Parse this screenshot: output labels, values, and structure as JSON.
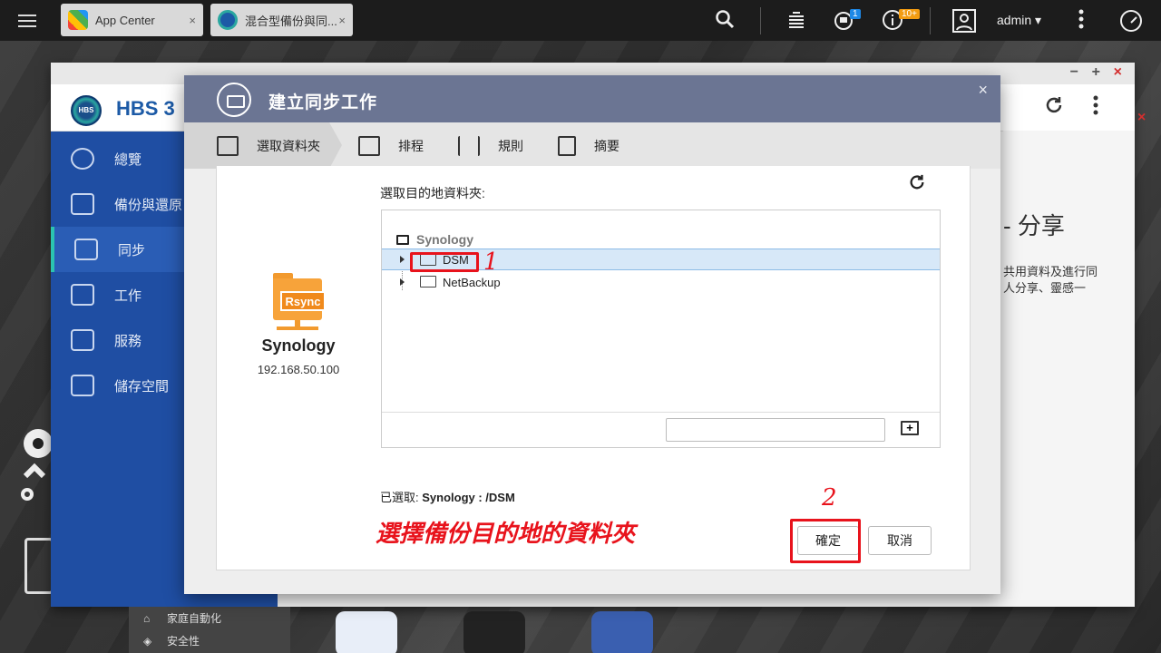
{
  "topbar": {
    "tabs": [
      {
        "label": "App Center",
        "close": "×"
      },
      {
        "label": "混合型備份與同...",
        "close": "×"
      }
    ],
    "badges": {
      "notifications": "1",
      "events": "10+"
    },
    "user": "admin",
    "user_caret": "▾"
  },
  "hbs": {
    "title": "HBS 3",
    "logo": "HBS",
    "window_controls": [
      "−",
      "+",
      "×"
    ],
    "sidebar": [
      {
        "label": "總覽"
      },
      {
        "label": "備份與還原"
      },
      {
        "label": "同步"
      },
      {
        "label": "工作"
      },
      {
        "label": "服務"
      },
      {
        "label": "儲存空間"
      }
    ],
    "share_title": "分享",
    "share_text_1": "共用資料及進行同",
    "share_text_2": "人分享、靈感一",
    "close_secondary": "×"
  },
  "desktop_panel": {
    "items": [
      {
        "label": "家庭自動化"
      },
      {
        "label": "安全性"
      }
    ]
  },
  "dialog": {
    "title": "建立同步工作",
    "close": "×",
    "steps": [
      {
        "label": "選取資料夾"
      },
      {
        "label": "排程"
      },
      {
        "label": "規則"
      },
      {
        "label": "摘要"
      }
    ],
    "source": {
      "badge": "Rsync",
      "name": "Synology",
      "ip": "192.168.50.100"
    },
    "pick_label": "選取目的地資料夾:",
    "tree": {
      "root": "Synology",
      "items": [
        "DSM",
        "NetBackup"
      ]
    },
    "selected_prefix": "已選取:",
    "selected_value": "Synology : /DSM",
    "ok_label": "確定",
    "cancel_label": "取消"
  },
  "annotations": {
    "step1": "1",
    "step2": "2",
    "note": "選擇備份目的地的資料夾"
  },
  "colors": {
    "dialog_header": "#6b7593",
    "sidebar": "#1f4ea3",
    "selection": "#d7e8f8",
    "annotation": "#e8131c",
    "rsync_orange": "#f7a33a"
  },
  "icons": {
    "menu": "menu-icon",
    "search": "search-icon",
    "tasks": "stack-icon",
    "notifications": "bell-icon",
    "events": "info-icon",
    "user": "user-icon",
    "more": "more-vertical-icon",
    "dashboard": "gauge-icon",
    "refresh": "refresh-icon",
    "new_folder": "new-folder-icon"
  }
}
